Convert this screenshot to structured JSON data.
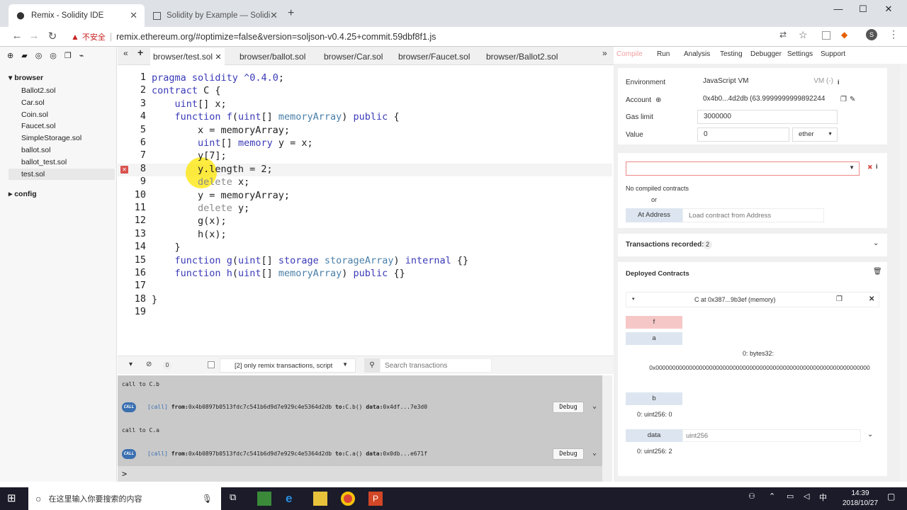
{
  "browser": {
    "tabs": [
      {
        "title": "Remix - Solidity IDE",
        "active": true
      },
      {
        "title": "Solidity by Example — Solidi",
        "active": false
      }
    ],
    "insecure_label": "不安全",
    "url": "remix.ethereum.org/#optimize=false&version=soljson-v0.4.25+commit.59dbf8f1.js",
    "avatar_letter": "S"
  },
  "file_explorer": {
    "browser_folder": "browser",
    "files": [
      "Ballot2.sol",
      "Car.sol",
      "Coin.sol",
      "Faucet.sol",
      "SimpleStorage.sol",
      "ballot.sol",
      "ballot_test.sol",
      "test.sol"
    ],
    "selected_file": "test.sol",
    "config_folder": "config"
  },
  "editor_tabs": [
    "browser/test.sol",
    "browser/ballot.sol",
    "browser/Car.sol",
    "browser/Faucet.sol",
    "browser/Ballot2.sol"
  ],
  "active_editor_tab": "browser/test.sol",
  "code_lines": [
    "1",
    "2",
    "3",
    "4",
    "5",
    "6",
    "7",
    "8",
    "9",
    "10",
    "11",
    "12",
    "13",
    "14",
    "15",
    "16",
    "17",
    "18",
    "19"
  ],
  "error_line": "8",
  "console": {
    "pending_count": "0",
    "filter_label": "[2] only remix transactions, script",
    "search_placeholder": "Search transactions",
    "entries": [
      {
        "label": "call to C.b",
        "tag": "[call]",
        "from_label": "from:",
        "from": "0x4b0897b0513fdc7c541b6d9d7e929c4e5364d2db",
        "to_label": "to:",
        "to": "C.b()",
        "data_label": "data:",
        "data": "0x4df...7e3d0",
        "debug": "Debug"
      },
      {
        "label": "call to C.a",
        "tag": "[call]",
        "from_label": "from:",
        "from": "0x4b0897b0513fdc7c541b6d9d7e929c4e5364d2db",
        "to_label": "to:",
        "to": "C.a()",
        "data_label": "data:",
        "data": "0x0db...e671f",
        "debug": "Debug"
      }
    ],
    "prompt": ">"
  },
  "right_tabs": [
    "Compile",
    "Run",
    "Analysis",
    "Testing",
    "Debugger",
    "Settings",
    "Support"
  ],
  "run": {
    "environment_label": "Environment",
    "environment_value": "JavaScript VM",
    "vm_label": "VM (-)",
    "account_label": "Account",
    "account_value": "0x4b0...4d2db (63.9999999999892244",
    "gas_limit_label": "Gas limit",
    "gas_limit_value": "3000000",
    "value_label": "Value",
    "value_value": "0",
    "value_unit": "ether",
    "no_compiled": "No compiled contracts",
    "or": "or",
    "at_address": "At Address",
    "load_placeholder": "Load contract from Address",
    "tx_recorded_label": "Transactions recorded:",
    "tx_recorded_count": "2",
    "deployed_label": "Deployed Contracts",
    "instance_title": "C at 0x387...9b3ef (memory)",
    "fn_f": "f",
    "fn_a": "a",
    "a_result_label": "0: bytes32:",
    "a_result_value": "0x0000000000000000000000000000000000000000000000000000000000000000",
    "fn_b": "b",
    "b_result": "0: uint256: 0",
    "fn_data": "data",
    "data_placeholder": "uint256",
    "data_result": "0: uint256: 2"
  },
  "taskbar": {
    "search_placeholder": "在这里输入你要搜索的内容",
    "time": "14:39",
    "date": "2018/10/27"
  }
}
